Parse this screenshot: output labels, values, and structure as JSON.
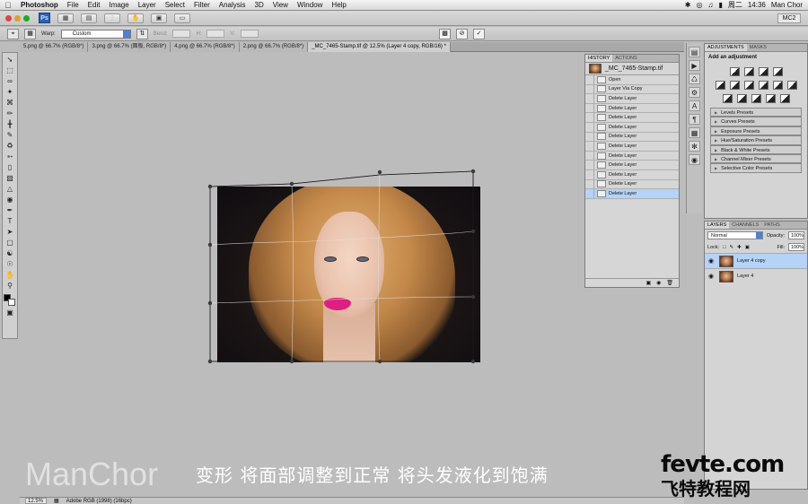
{
  "menubar": {
    "apple": "",
    "app": "Photoshop",
    "items": [
      "File",
      "Edit",
      "Image",
      "Layer",
      "Select",
      "Filter",
      "Analysis",
      "3D",
      "View",
      "Window",
      "Help"
    ],
    "day": "周二",
    "time": "14:36",
    "user": "Man Chor"
  },
  "appbar": {
    "badge": "Ps",
    "workspace": "MC2"
  },
  "options": {
    "warp_label": "Warp:",
    "warp_value": "Custom",
    "bend_label": "Bend:",
    "h_label": "H:",
    "v_label": "V:"
  },
  "tabs": [
    {
      "label": "5.png @ 66.7% (RGB/8*)"
    },
    {
      "label": "3.png @ 66.7% (面板, RGB/8*)"
    },
    {
      "label": "4.png @ 66.7% (RGB/8*)"
    },
    {
      "label": "2.png @ 66.7% (RGB/8*)"
    },
    {
      "label": "_MC_7465-Stamp.tif @ 12.5% (Layer 4 copy, RGB/16) *"
    }
  ],
  "history": {
    "tabs": [
      "HISTORY",
      "ACTIONS"
    ],
    "snapshot": "_MC_7465-Stamp.tif",
    "items": [
      "Open",
      "Layer Via Copy",
      "Delete Layer",
      "Delete Layer",
      "Delete Layer",
      "Delete Layer",
      "Delete Layer",
      "Delete Layer",
      "Delete Layer",
      "Delete Layer",
      "Delete Layer",
      "Delete Layer",
      "Delete Layer"
    ],
    "selected_index": 12
  },
  "adjustments": {
    "tabs": [
      "ADJUSTMENTS",
      "MASKS"
    ],
    "title": "Add an adjustment",
    "presets": [
      "Levels Presets",
      "Curves Presets",
      "Exposure Presets",
      "Hue/Saturation Presets",
      "Black & White Presets",
      "Channel Mixer Presets",
      "Selective Color Presets"
    ]
  },
  "layers": {
    "tabs": [
      "LAYERS",
      "CHANNELS",
      "PATHS"
    ],
    "blend": "Normal",
    "opacity_label": "Opacity:",
    "opacity": "100%",
    "lock_label": "Lock:",
    "fill_label": "Fill:",
    "fill": "100%",
    "items": [
      {
        "name": "Layer 4 copy",
        "selected": true
      },
      {
        "name": "Layer 4",
        "selected": false
      }
    ]
  },
  "status": {
    "zoom": "12.5%",
    "profile": "Adobe RGB (1998) (16bpc)"
  },
  "overlay": {
    "watermark": "ManChor",
    "subtitle": "变形 将面部调整到正常 将头发液化到饱满",
    "brand_top": "fevte.com",
    "brand_bottom": "飞特教程网"
  },
  "colors": {
    "accent": "#4d7fd6",
    "selection": "#b5d2f7",
    "lips": "#e01d80"
  }
}
